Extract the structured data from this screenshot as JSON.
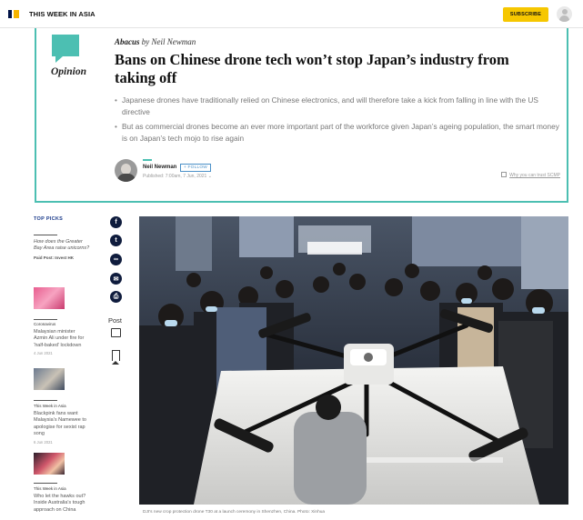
{
  "header": {
    "brand": "THIS WEEK IN ASIA",
    "subscribe_label": "SUBSCRIBE",
    "icons": {
      "logo": "scmp-logo-icon",
      "user": "user-avatar-icon"
    }
  },
  "article": {
    "section_label": "Opinion",
    "column": "Abacus",
    "byline_prefix": "by",
    "byline_author": "Neil Newman",
    "headline": "Bans on Chinese drone tech won’t stop Japan’s industry from taking off",
    "bullets": [
      "Japanese drones have traditionally relied on Chinese electronics, and will therefore take a kick from falling in line with the US directive",
      "But as commercial drones become an ever more important part of the workforce given Japan’s ageing population, the smart money is on Japan’s tech mojo to rise again"
    ],
    "author": {
      "name": "Neil Newman",
      "follow_label": "+ FOLLOW",
      "published": "Published: 7:00am, 7 Jun, 2021 ⌄"
    },
    "trust_link": "Why you can trust SCMP",
    "image_caption": "DJI’s new crop protection drone T30 at a launch ceremony in Shenzhen, China. Photo: Xinhua",
    "colors": {
      "accent": "#4cbfb2",
      "brand_navy": "#001246",
      "brand_yellow": "#f6b400",
      "subscribe": "#f6c700"
    }
  },
  "top_picks": {
    "heading": "TOP PICKS",
    "items": [
      {
        "title": "How does the Greater Bay Area raise unicorns?",
        "source": "Paid Post: Invest HK"
      },
      {
        "tag": "Coronavirus",
        "title": "Malaysian minister Azmin Ali under fire for ‘half-baked’ lockdown",
        "date": "4 Jun 2021"
      },
      {
        "tag": "This Week in Asia",
        "title": "Blackpink fans want Malaysia’s Namewee to apologise for sexist rap song",
        "date": "6 Jun 2021"
      },
      {
        "tag": "This Week in Asia",
        "title": "Who let the hawks out? Inside Australia’s tough approach on China"
      }
    ]
  },
  "share": {
    "icons": [
      "facebook-icon",
      "twitter-icon",
      "link-icon",
      "email-icon",
      "print-icon"
    ],
    "post_label": "Post"
  }
}
